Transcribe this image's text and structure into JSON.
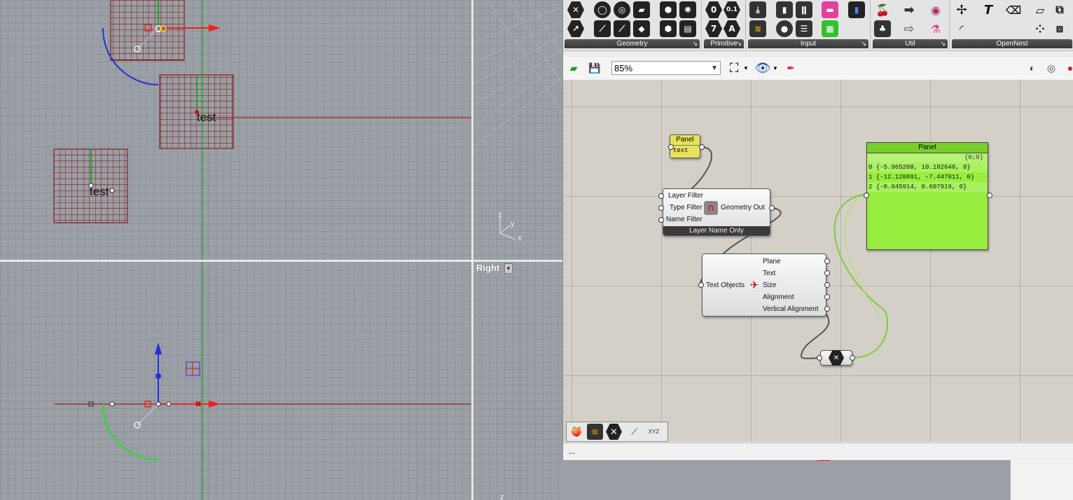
{
  "viewports": {
    "top_left": {
      "text_label_a": "test",
      "text_label_b": "test"
    },
    "right_label": "Right",
    "axis_labels": {
      "z": "z",
      "y": "y",
      "x": "x",
      "z2": "z"
    }
  },
  "ribbon": {
    "groups": [
      {
        "name": "Geometry"
      },
      {
        "name": "Primitive"
      },
      {
        "name": "Input"
      },
      {
        "name": "Util"
      },
      {
        "name": "OpenNest"
      }
    ],
    "primitive_icons": [
      "0",
      "0.1",
      "7",
      "A"
    ],
    "pin_glyph": "↘"
  },
  "toolbar": {
    "zoom": "85%"
  },
  "canvas": {
    "panel_small": {
      "title": "Panel",
      "content": "text"
    },
    "filter_component": {
      "inputs": [
        "Layer Filter",
        "Type Filter",
        "Name Filter"
      ],
      "output": "Geometry Out",
      "footer": "Layer Name Only"
    },
    "text_component": {
      "input": "Text Objects",
      "outputs": [
        "Plane",
        "Text",
        "Size",
        "Alignment",
        "Vertical Alignment"
      ]
    },
    "panel_large": {
      "title": "Panel",
      "path": "{0;0}",
      "rows": [
        "0 {-5.965208, 10.182648, 0}",
        "1 {-12.120891, -7.447011, 0}",
        "2 {-0.645914, 0.607919, 0}"
      ]
    },
    "bottom_icons": [
      "XYZ"
    ]
  },
  "status": {
    "text": "..."
  },
  "colors": {
    "viewport_bg": "#9aa0a6",
    "canvas_bg": "#d4d0c8",
    "panel_yellow": "#e8e25a",
    "panel_green": "#98ee3e",
    "axis_red": "#e02020",
    "axis_green": "#20a020",
    "axis_blue": "#2030e0",
    "grid_dark_red": "#8b0000"
  }
}
